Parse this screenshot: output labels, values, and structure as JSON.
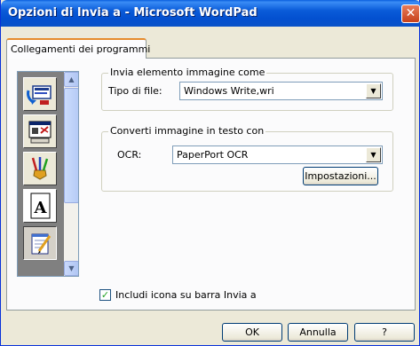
{
  "window": {
    "title": "Opzioni di Invia a - Microsoft WordPad",
    "close_glyph": "✕"
  },
  "tabs": [
    {
      "label": "Collegamenti dei programmi"
    }
  ],
  "icon_list": {
    "items": [
      {
        "icon": "send-arrows-icon",
        "selected": false
      },
      {
        "icon": "scanner-window-icon",
        "selected": false
      },
      {
        "icon": "paintbrushes-icon",
        "selected": false
      },
      {
        "icon": "text-A-icon",
        "selected": false
      },
      {
        "icon": "notepad-pen-icon",
        "selected": true
      }
    ],
    "scroll_up_glyph": "▲",
    "scroll_down_glyph": "▼"
  },
  "image_group": {
    "title": "Invia elemento immagine come",
    "file_type_label": "Tipo di file:",
    "file_type_value": "Windows Write,wri",
    "dropdown_glyph": "▼"
  },
  "ocr_group": {
    "title": "Converti immagine in testo con",
    "ocr_label": "OCR:",
    "ocr_value": "PaperPort OCR",
    "dropdown_glyph": "▼",
    "settings_button": "Impostazioni..."
  },
  "checkbox": {
    "label": "Includi icona su barra Invia a",
    "checked": true,
    "glyph": "✓"
  },
  "footer": {
    "ok": "OK",
    "cancel": "Annulla",
    "help": "?"
  }
}
